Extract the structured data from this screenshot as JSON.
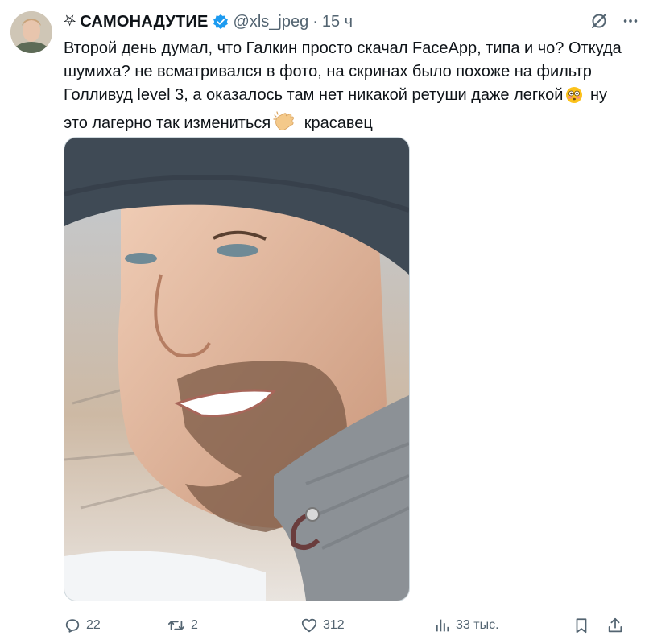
{
  "tweet": {
    "name_symbol": "⛧",
    "display_name": "САМОНАДУТИЕ",
    "handle": "@xls_jpeg",
    "separator": "·",
    "time": "15 ч",
    "text_part1": "Второй день думал, что Галкин просто скачал FaceApp, типа и чо? Откуда шумиха? не всматривался в фото, на скринах было похоже на фильтр Голливуд level 3, а оказалось там нет никакой ретуши даже легкой",
    "text_part2": " ну это лагерно так измениться",
    "text_part3": " красавец",
    "emoji1": "flushed-face",
    "emoji2": "clapping-hands"
  },
  "stats": {
    "replies": "22",
    "reposts": "2",
    "likes": "312",
    "views": "33 тыс."
  },
  "colors": {
    "verified": "#1d9bf0",
    "muted": "#536471",
    "text": "#0f1419"
  }
}
